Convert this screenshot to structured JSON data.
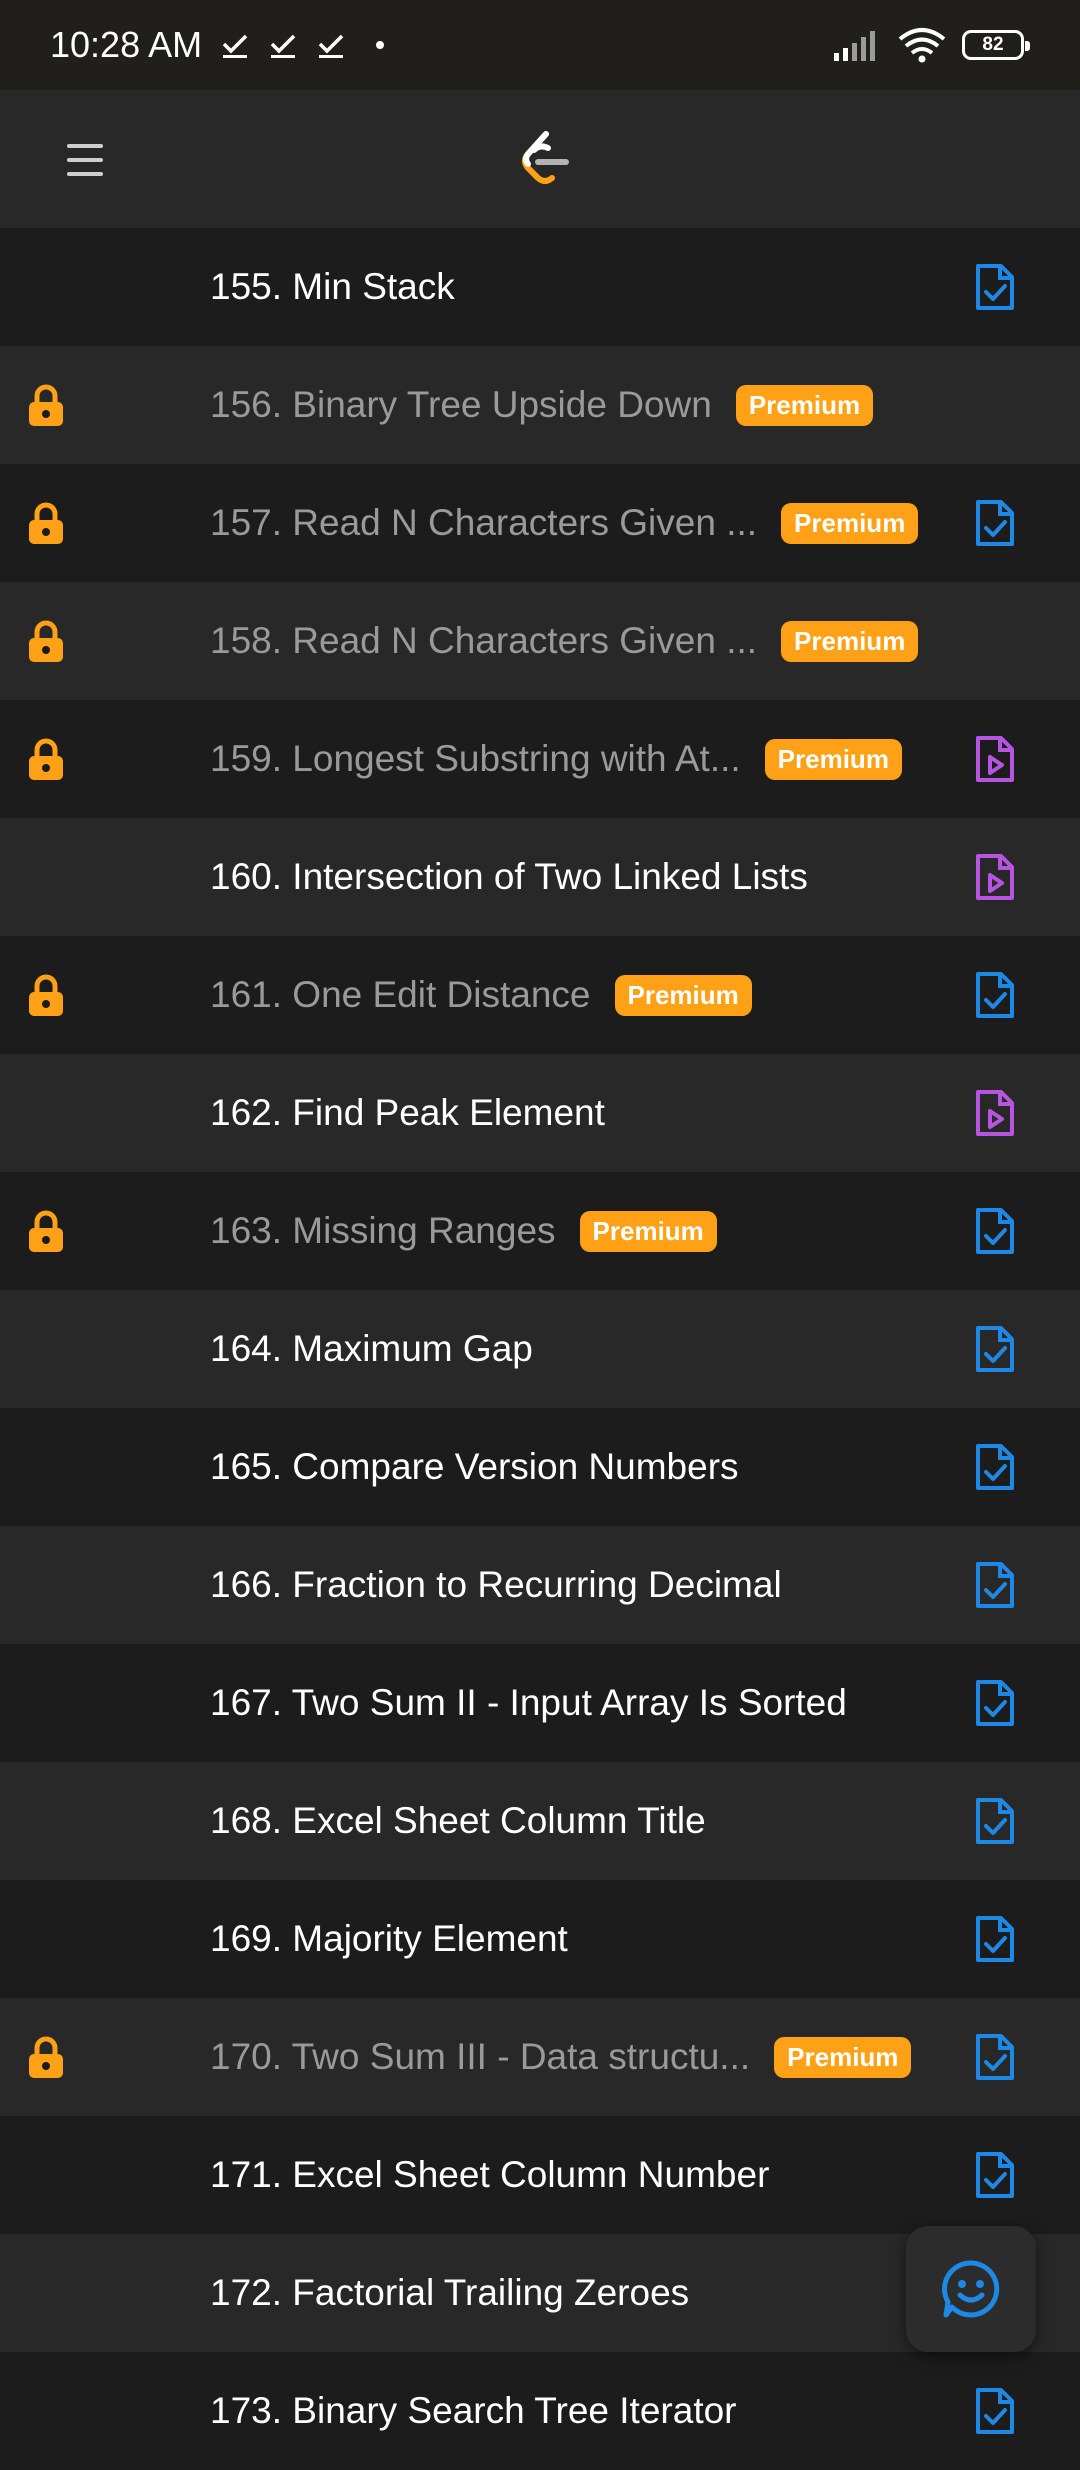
{
  "status_bar": {
    "time": "10:28 AM",
    "battery": "82",
    "notification_icons": [
      "download-done-icon",
      "download-done-icon",
      "download-done-icon"
    ]
  },
  "header": {
    "menu_icon": "hamburger-menu-icon",
    "logo": "leetcode-logo"
  },
  "colors": {
    "premium": "#ffa116",
    "solution_icon": "#1e88e5",
    "video_icon": "#b855e0",
    "row_dark": "#1c1c1c",
    "row_light": "#282828"
  },
  "problems": [
    {
      "title": "155. Min Stack",
      "locked": false,
      "premium": false,
      "icon": "solution-check-icon"
    },
    {
      "title": "156. Binary Tree Upside Down",
      "locked": true,
      "premium": true,
      "icon": ""
    },
    {
      "title": "157. Read N Characters Given ...",
      "locked": true,
      "premium": true,
      "icon": "solution-check-icon"
    },
    {
      "title": "158. Read N Characters Given ...",
      "locked": true,
      "premium": true,
      "icon": ""
    },
    {
      "title": "159. Longest Substring with At...",
      "locked": true,
      "premium": true,
      "icon": "video-solution-icon"
    },
    {
      "title": "160. Intersection of Two Linked Lists",
      "locked": false,
      "premium": false,
      "icon": "video-solution-icon"
    },
    {
      "title": "161. One Edit Distance",
      "locked": true,
      "premium": true,
      "icon": "solution-check-icon"
    },
    {
      "title": "162. Find Peak Element",
      "locked": false,
      "premium": false,
      "icon": "video-solution-icon"
    },
    {
      "title": "163. Missing Ranges",
      "locked": true,
      "premium": true,
      "icon": "solution-check-icon"
    },
    {
      "title": "164. Maximum Gap",
      "locked": false,
      "premium": false,
      "icon": "solution-check-icon"
    },
    {
      "title": "165. Compare Version Numbers",
      "locked": false,
      "premium": false,
      "icon": "solution-check-icon"
    },
    {
      "title": "166. Fraction to Recurring Decimal",
      "locked": false,
      "premium": false,
      "icon": "solution-check-icon"
    },
    {
      "title": "167. Two Sum II - Input Array Is Sorted",
      "locked": false,
      "premium": false,
      "icon": "solution-check-icon"
    },
    {
      "title": "168. Excel Sheet Column Title",
      "locked": false,
      "premium": false,
      "icon": "solution-check-icon"
    },
    {
      "title": "169. Majority Element",
      "locked": false,
      "premium": false,
      "icon": "solution-check-icon"
    },
    {
      "title": "170. Two Sum III - Data structu...",
      "locked": true,
      "premium": true,
      "icon": "solution-check-icon"
    },
    {
      "title": "171. Excel Sheet Column Number",
      "locked": false,
      "premium": false,
      "icon": "solution-check-icon"
    },
    {
      "title": "172. Factorial Trailing Zeroes",
      "locked": false,
      "premium": false,
      "icon": ""
    },
    {
      "title": "173. Binary Search Tree Iterator",
      "locked": false,
      "premium": false,
      "icon": "solution-check-icon"
    }
  ],
  "premium_label": "Premium",
  "fab": {
    "icon": "feedback-smiley-icon"
  }
}
